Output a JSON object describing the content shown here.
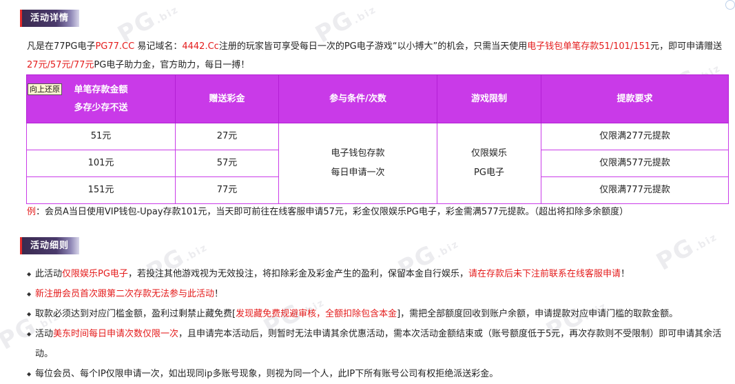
{
  "watermark": "PG",
  "watermark_sub": ".biz",
  "section1": {
    "title": "活动详情"
  },
  "intro": {
    "p1": "凡是在77PG电子",
    "site": "PG77.CC",
    "p2": " 易记域名：",
    "domain": "4442.Cc",
    "p3": "注册的玩家皆可享受每日一次的PG电子游戏“以小搏大”的机会，只需当天使用",
    "deposit_hl": "电子钱包单笔存款51/101/151",
    "p4": "元，即可申请赠送",
    "bonus_hl": "27元/57元/77元",
    "p5": "PG电子助力金，官方助力，每日一搏！"
  },
  "table": {
    "back_button": "向上还原",
    "headers": {
      "deposit_line1": "单笔存款金额",
      "deposit_line2": "多存少存不送",
      "bonus": "赠送彩金",
      "condition": "参与条件/次数",
      "game": "游戏限制",
      "withdraw": "提款要求"
    },
    "rows": [
      {
        "deposit": "51元",
        "bonus": "27元",
        "withdraw": "仅限满277元提款"
      },
      {
        "deposit": "101元",
        "bonus": "57元",
        "withdraw": "仅限满577元提款"
      },
      {
        "deposit": "151元",
        "bonus": "77元",
        "withdraw": "仅限满777元提款"
      }
    ],
    "condition_line1": "电子钱包存款",
    "condition_line2": "每日申请一次",
    "game_line1": "仅限娱乐",
    "game_line2": "PG电子"
  },
  "example": {
    "label": "例",
    "text": "：会员A当日使用VIP钱包-Upay存款101元，当天即可前往在线客服申请57元，彩金仅限娱乐PG电子，彩金需满577元提款。（超出将扣除多余额度）"
  },
  "section2": {
    "title": "活动细则"
  },
  "rules": {
    "r1_a": "此活动",
    "r1_hl1": "仅限娱乐PG电子",
    "r1_b": "，若投注其他游戏视为无效投注，将扣除彩金及彩金产生的盈利，保留本金自行娱乐，",
    "r1_hl2": "请在存款后未下注前联系在线客服申请",
    "r1_c": "！",
    "r2_hl": "新注册会员首次跟第二次存款无法参与此活动",
    "r2_c": "！",
    "r3_a": "取款必须达到对应门槛金额，盈利过剩禁止藏免费[",
    "r3_hl": "发现藏免费规避审核，全额扣除包含本金",
    "r3_b": "]，需把全部额度回收到账户余额，申请提款对应申请门槛的取款金额。",
    "r4_a": "活动",
    "r4_hl": "美东时间每日申请次数仅限一次",
    "r4_b": "，且申请完本活动后，则暂时无法申请其余优惠活动，需本次活动金额结束或（账号额度低于5元，再次存款则不受限制）即可申请其余活动。",
    "r5": "每位会员、每个IP仅限申请一次，如出现同ip多账号现象，则视为同一个人，此IP下所有账号公司有权拒绝派送彩金。"
  }
}
